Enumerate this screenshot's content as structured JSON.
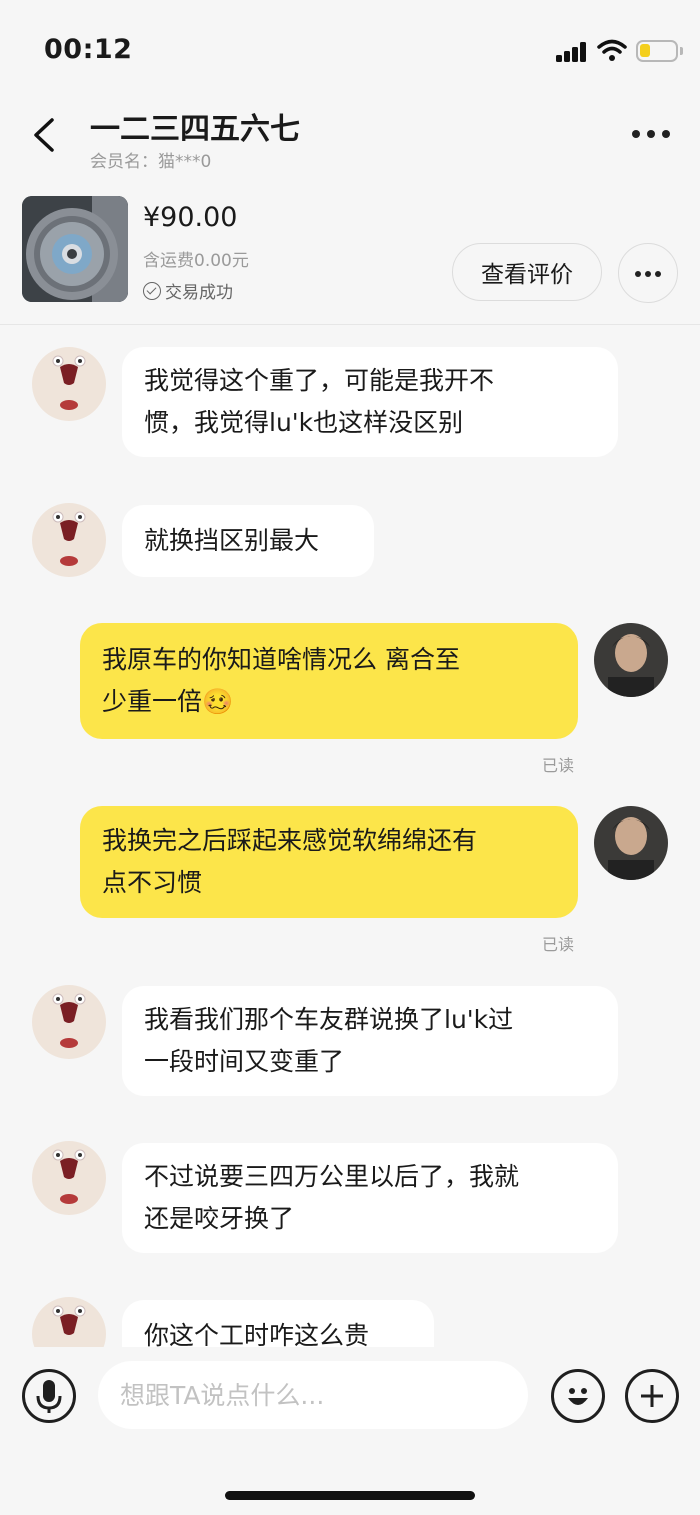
{
  "status_bar": {
    "time": "00:12",
    "signal_icon": "signal-bars-icon",
    "wifi_icon": "wifi-icon",
    "battery_icon": "battery-icon"
  },
  "header": {
    "contact_name": "一二三四五六七",
    "member_label": "会员名：猫***0"
  },
  "product": {
    "price": "¥90.00",
    "shipping": "含运费0.00元",
    "status": "交易成功",
    "review_button": "查看评价",
    "image_desc_icon": "clutch-disc-photo"
  },
  "messages": [
    {
      "side": "in",
      "lines": [
        "我觉得这个重了，可能是我开不",
        "惯，我觉得lu'k也这样没区别"
      ]
    },
    {
      "side": "in",
      "lines": [
        "就换挡区别最大"
      ]
    },
    {
      "side": "out",
      "lines": [
        "我原车的你知道啥情况么 离合至",
        "少重一倍🥴"
      ],
      "read": "已读"
    },
    {
      "side": "out",
      "lines": [
        "我换完之后踩起来感觉软绵绵还有",
        "点不习惯"
      ],
      "read": "已读"
    },
    {
      "side": "in",
      "lines": [
        "我看我们那个车友群说换了lu'k过",
        "一段时间又变重了"
      ]
    },
    {
      "side": "in",
      "lines": [
        "不过说要三四万公里以后了，我就",
        "还是咬牙换了"
      ]
    },
    {
      "side": "in",
      "lines": [
        "你这个工时咋这么贵"
      ]
    }
  ],
  "input": {
    "placeholder": "想跟TA说点什么..."
  },
  "colors": {
    "outgoing_bubble": "#fce54a",
    "incoming_bubble": "#ffffff",
    "background": "#f6f6f6"
  }
}
